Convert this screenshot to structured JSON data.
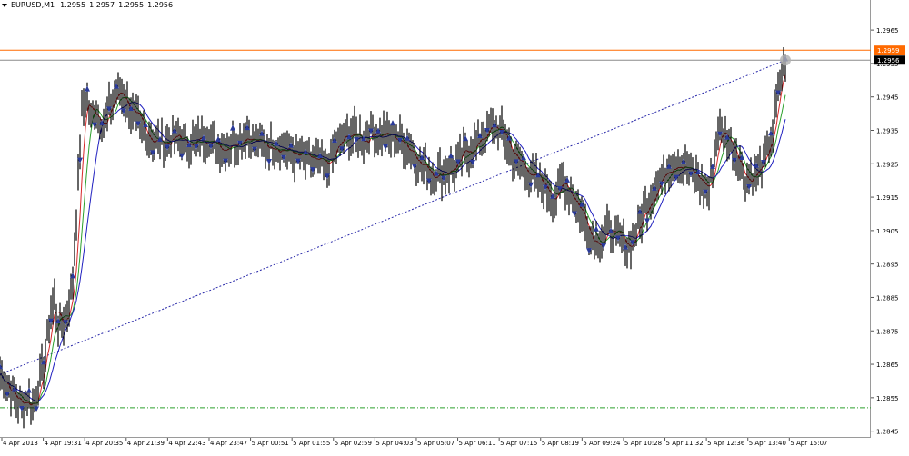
{
  "window": {
    "symbol_timeframe": "EURUSD,M1",
    "ohlc": [
      "1.2955",
      "1.2957",
      "1.2955",
      "1.2956"
    ]
  },
  "price_axis": {
    "ticks": [
      "1.2965",
      "1.2955",
      "1.2945",
      "1.2935",
      "1.2925",
      "1.2915",
      "1.2905",
      "1.2895",
      "1.2885",
      "1.2875",
      "1.2865",
      "1.2855",
      "1.2845"
    ],
    "ask_label": "1.2959",
    "bid_label": "1.2956",
    "colors": {
      "ask": "#ff6a00",
      "bid": "#000000"
    }
  },
  "time_axis": {
    "ticks": [
      "4 Apr 2013",
      "4 Apr 19:31",
      "4 Apr 20:35",
      "4 Apr 21:39",
      "4 Apr 22:43",
      "4 Apr 23:47",
      "5 Apr 00:51",
      "5 Apr 01:55",
      "5 Apr 02:59",
      "5 Apr 04:03",
      "5 Apr 05:07",
      "5 Apr 06:11",
      "5 Apr 07:15",
      "5 Apr 08:19",
      "5 Apr 09:24",
      "5 Apr 10:28",
      "5 Apr 11:32",
      "5 Apr 12:36",
      "5 Apr 13:40",
      "5 Apr 15:07"
    ]
  },
  "chart_data": {
    "type": "line",
    "symbol": "EURUSD",
    "timeframe": "M1",
    "ylim": [
      1.2843,
      1.2974
    ],
    "x": [
      "4 Apr 2013",
      "4 Apr 19:31",
      "4 Apr 20:35",
      "4 Apr 21:39",
      "4 Apr 22:43",
      "4 Apr 23:47",
      "5 Apr 00:51",
      "5 Apr 01:55",
      "5 Apr 02:59",
      "5 Apr 04:03",
      "5 Apr 05:07",
      "5 Apr 06:11",
      "5 Apr 07:15",
      "5 Apr 08:19",
      "5 Apr 09:24",
      "5 Apr 10:28",
      "5 Apr 11:32",
      "5 Apr 12:36",
      "5 Apr 13:40",
      "5 Apr 15:07"
    ],
    "price": [
      [
        0,
        1.2862
      ],
      [
        5,
        1.286
      ],
      [
        10,
        1.2858
      ],
      [
        15,
        1.2855
      ],
      [
        20,
        1.2854
      ],
      [
        25,
        1.2853
      ],
      [
        30,
        1.2855
      ],
      [
        35,
        1.2852
      ],
      [
        40,
        1.2856
      ],
      [
        45,
        1.2862
      ],
      [
        50,
        1.2868
      ],
      [
        55,
        1.288
      ],
      [
        60,
        1.2884
      ],
      [
        65,
        1.2876
      ],
      [
        70,
        1.2878
      ],
      [
        75,
        1.2882
      ],
      [
        80,
        1.289
      ],
      [
        85,
        1.2915
      ],
      [
        90,
        1.294
      ],
      [
        95,
        1.2946
      ],
      [
        100,
        1.2938
      ],
      [
        105,
        1.2942
      ],
      [
        110,
        1.2938
      ],
      [
        115,
        1.2937
      ],
      [
        120,
        1.2941
      ],
      [
        125,
        1.2945
      ],
      [
        130,
        1.2947
      ],
      [
        135,
        1.2945
      ],
      [
        140,
        1.2943
      ],
      [
        145,
        1.294
      ],
      [
        150,
        1.2938
      ],
      [
        155,
        1.2935
      ],
      [
        160,
        1.2934
      ],
      [
        170,
        1.2932
      ],
      [
        180,
        1.2931
      ],
      [
        190,
        1.2933
      ],
      [
        200,
        1.2932
      ],
      [
        210,
        1.2931
      ],
      [
        220,
        1.2932
      ],
      [
        230,
        1.2933
      ],
      [
        240,
        1.293
      ],
      [
        250,
        1.2931
      ],
      [
        260,
        1.2932
      ],
      [
        270,
        1.2934
      ],
      [
        280,
        1.2932
      ],
      [
        290,
        1.293
      ],
      [
        300,
        1.2931
      ],
      [
        310,
        1.293
      ],
      [
        320,
        1.2928
      ],
      [
        330,
        1.2927
      ],
      [
        340,
        1.2926
      ],
      [
        350,
        1.2925
      ],
      [
        360,
        1.2924
      ],
      [
        370,
        1.293
      ],
      [
        380,
        1.2933
      ],
      [
        390,
        1.2934
      ],
      [
        400,
        1.2932
      ],
      [
        410,
        1.2935
      ],
      [
        420,
        1.2934
      ],
      [
        430,
        1.2933
      ],
      [
        440,
        1.2932
      ],
      [
        450,
        1.293
      ],
      [
        460,
        1.2926
      ],
      [
        470,
        1.2923
      ],
      [
        480,
        1.2922
      ],
      [
        490,
        1.2923
      ],
      [
        500,
        1.2924
      ],
      [
        510,
        1.2928
      ],
      [
        520,
        1.293
      ],
      [
        530,
        1.2933
      ],
      [
        540,
        1.2936
      ],
      [
        550,
        1.2935
      ],
      [
        560,
        1.293
      ],
      [
        570,
        1.2925
      ],
      [
        580,
        1.2923
      ],
      [
        590,
        1.292
      ],
      [
        600,
        1.2918
      ],
      [
        610,
        1.2915
      ],
      [
        620,
        1.292
      ],
      [
        630,
        1.2915
      ],
      [
        640,
        1.291
      ],
      [
        650,
        1.2903
      ],
      [
        660,
        1.2902
      ],
      [
        670,
        1.2905
      ],
      [
        680,
        1.2903
      ],
      [
        690,
        1.29
      ],
      [
        700,
        1.2905
      ],
      [
        710,
        1.2912
      ],
      [
        720,
        1.2918
      ],
      [
        730,
        1.2922
      ],
      [
        740,
        1.2926
      ],
      [
        750,
        1.2925
      ],
      [
        760,
        1.2922
      ],
      [
        770,
        1.292
      ],
      [
        780,
        1.2917
      ],
      [
        790,
        1.2935
      ],
      [
        800,
        1.2933
      ],
      [
        810,
        1.2928
      ],
      [
        820,
        1.292
      ],
      [
        830,
        1.2922
      ],
      [
        840,
        1.2925
      ],
      [
        850,
        1.2935
      ],
      [
        855,
        1.2945
      ],
      [
        860,
        1.2952
      ],
      [
        864,
        1.2956
      ]
    ],
    "horizontal_lines": [
      {
        "name": "ask",
        "value": 1.2959,
        "color": "#ff6a00",
        "style": "solid"
      },
      {
        "name": "bid",
        "value": 1.2956,
        "color": "#8c8c8c",
        "style": "solid"
      },
      {
        "name": "level-a",
        "value": 1.2854,
        "color": "#2ca02c",
        "style": "dash-dot"
      },
      {
        "name": "level-b",
        "value": 1.2852,
        "color": "#2ca02c",
        "style": "dash-dot"
      }
    ],
    "trend_line": {
      "from": [
        0,
        1.2862
      ],
      "to": [
        864,
        1.2956
      ],
      "color": "#2a2aaa",
      "style": "dotted"
    },
    "moving_averages": [
      {
        "color": "#d62728",
        "lag": 4
      },
      {
        "color": "#2ca02c",
        "lag": 8
      },
      {
        "color": "#1f1fbf",
        "lag": 14
      }
    ],
    "grid": false
  }
}
